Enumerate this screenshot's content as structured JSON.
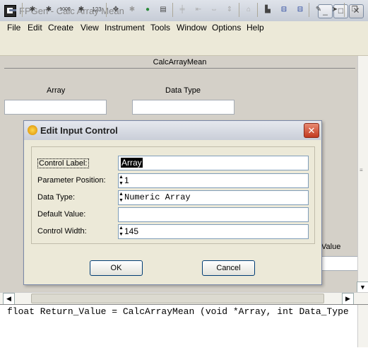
{
  "window": {
    "title": "FPGen - Calc Array Mean"
  },
  "menu": [
    "File",
    "Edit",
    "Create",
    "View",
    "Instrument",
    "Tools",
    "Window",
    "Options",
    "Help"
  ],
  "toolbar_icons": [
    "save-icon",
    "add-control-icon",
    "add-indicator-icon",
    "numeric-icon",
    "numeric-123-icon",
    "move-icon",
    "align-icon",
    "color-icon",
    "page-icon",
    "split-icon",
    "resize-icon",
    "link-icon",
    "adjust-icon",
    "home-icon",
    "tree-icon",
    "import-icon",
    "export-icon",
    "edit-icon",
    "run-icon",
    "copy-icon"
  ],
  "workspace": {
    "tab": "CalcArrayMean",
    "array_label": "Array",
    "datatype_label": "Data Type",
    "partial_value_label": "Value"
  },
  "dialog": {
    "title": "Edit Input Control",
    "fields": {
      "control_label": {
        "label": "Control Label:",
        "value": "Array"
      },
      "parameter_position": {
        "label": "Parameter Position:",
        "value": "1"
      },
      "data_type": {
        "label": "Data Type:",
        "value": "Numeric Array"
      },
      "default_value": {
        "label": "Default Value:",
        "value": ""
      },
      "control_width": {
        "label": "Control Width:",
        "value": "145"
      }
    },
    "ok": "OK",
    "cancel": "Cancel"
  },
  "signature": "float Return_Value = CalcArrayMean (void *Array, int Data_Type"
}
